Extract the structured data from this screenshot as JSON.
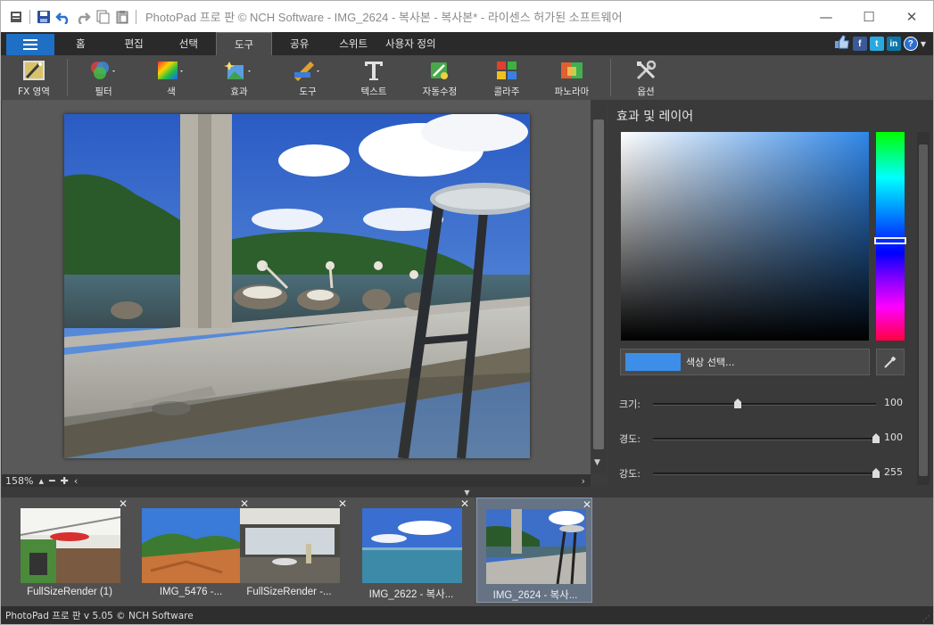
{
  "titlebar": {
    "title": "PhotoPad 프로 판 © NCH Software - IMG_2624 - 복사본 - 복사본* - 라이센스 허가된 소프트웨어",
    "minimize": "—",
    "maximize": "☐",
    "close": "✕"
  },
  "menu": {
    "tabs": [
      "홈",
      "편집",
      "선택",
      "도구",
      "공유",
      "스위트",
      "사용자 정의"
    ],
    "active": "도구"
  },
  "social": {
    "fb": "f",
    "tw": "t",
    "in": "in",
    "help": "?"
  },
  "toolbar": {
    "fx": "FX 영역",
    "filter": "필터",
    "color": "색",
    "effect": "효과",
    "tools": "도구",
    "text": "텍스트",
    "autofix": "자동수정",
    "collage": "콜라주",
    "panorama": "파노라마",
    "options": "옵션"
  },
  "canvas": {
    "zoom": "158%"
  },
  "panel": {
    "title": "효과 및 레이어",
    "color_button": "색상 선택...",
    "swatch_color": "#3d8ee8",
    "sliders": [
      {
        "label": "크기:",
        "value": "100",
        "fraction": 0.4
      },
      {
        "label": "경도:",
        "value": "100",
        "fraction": 1.0
      },
      {
        "label": "강도:",
        "value": "255",
        "fraction": 1.0
      }
    ]
  },
  "filmstrip": {
    "items": [
      {
        "caption": "FullSizeRender (1)",
        "selected": false
      },
      {
        "caption": "IMG_5476 -...",
        "selected": false
      },
      {
        "caption": "FullSizeRender -...",
        "selected": false
      },
      {
        "caption": "IMG_2622 - 복사...",
        "selected": false
      },
      {
        "caption": "IMG_2624 - 복사...",
        "selected": true
      }
    ]
  },
  "status": {
    "text": "PhotoPad 프로 판 v 5.05 © NCH Software"
  }
}
